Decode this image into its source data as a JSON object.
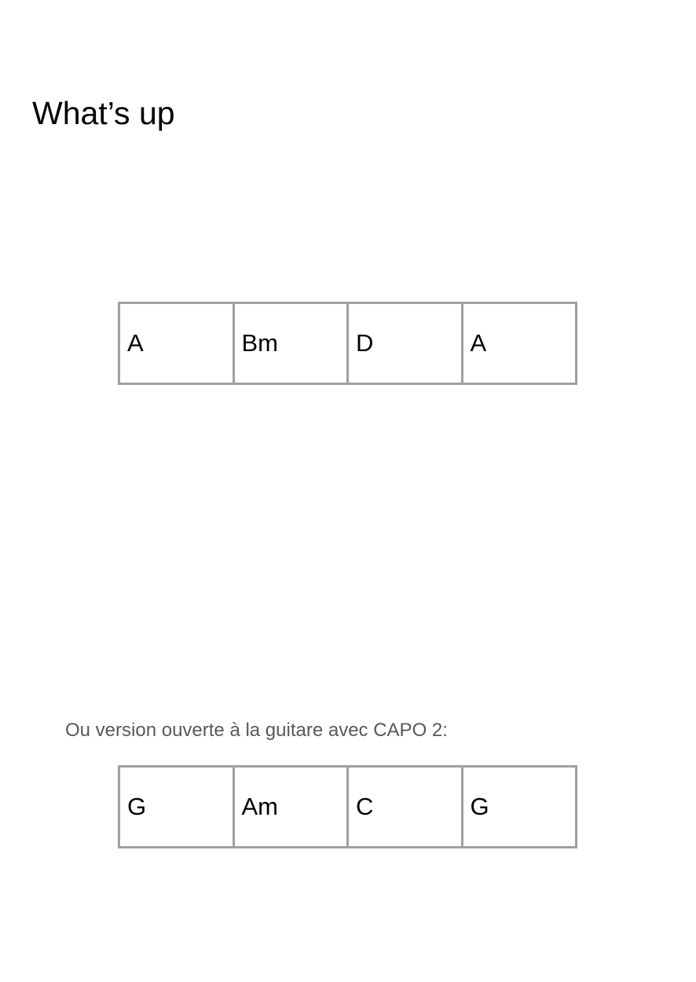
{
  "title": "What’s up",
  "progression_main": {
    "chords": [
      "A",
      "Bm",
      "D",
      "A"
    ]
  },
  "note": "Ou version ouverte à la guitare avec CAPO 2:",
  "progression_capo": {
    "chords": [
      "G",
      "Am",
      "C",
      "G"
    ]
  },
  "colors": {
    "table_border": "#a0a0a0",
    "note_text": "#595959",
    "text": "#000000"
  }
}
